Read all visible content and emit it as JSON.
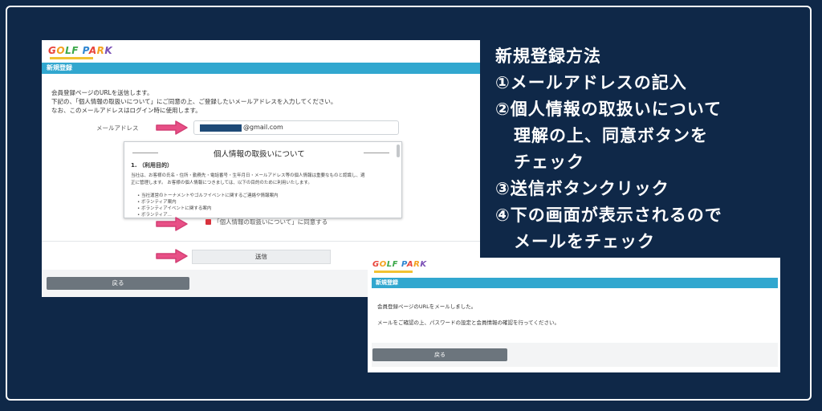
{
  "instructions": {
    "title": "新規登録方法",
    "step1": "①メールアドレスの記入",
    "step2a": "②個人情報の取扱いについて",
    "step2b": "理解の上、同意ボタンを",
    "step2c": "チェック",
    "step3": "③送信ボタンクリック",
    "step4a": "④下の画面が表示されるので",
    "step4b": "メールをチェック"
  },
  "form_screen": {
    "logo": "GOLF PARK",
    "section_title": "新規登録",
    "intro_1": "会員登録ページのURLを送信します。",
    "intro_2": "下記の、「個人情報の取扱いについて」にご同意の上、ご登録したいメールアドレスを入力してください。",
    "intro_3": "なお、このメールアドレスはログイン時に使用します。",
    "email_label": "メールアドレス",
    "email_value": "@gmail.com",
    "privacy": {
      "title": "個人情報の取扱いについて",
      "section": "1. （利用目的）",
      "body_1": "当社は、お客様の氏名・住所・勤務先・電話番号・生年月日・メールアドレス等の個人情報は重要なものと認識し、適",
      "body_2": "正に管理します。 お客様の個人情報につきましては、以下の目的のために利用いたします。",
      "items": [
        "当社運営のトーナメントやゴルフイベントに関するご連絡や情報案内",
        "ボランティア案内",
        "ボランティアイベントに関する案内",
        "ボランティア..."
      ]
    },
    "agree_label": "「個人情報の取扱いについて」に同意する",
    "submit_label": "送信",
    "back_label": "戻る"
  },
  "sent_screen": {
    "logo": "GOLF PARK",
    "section_title": "新規登録",
    "message_1": "会員登録ページのURLをメールしました。",
    "message_2": "メールをご確認の上、パスワードの設定と会員情報の確認を行ってください。",
    "back_label": "戻る"
  },
  "colors": {
    "background": "#0f2848",
    "accent_bar": "#31a7cf",
    "arrow": "#e84f86",
    "back_button": "#6c757d"
  }
}
